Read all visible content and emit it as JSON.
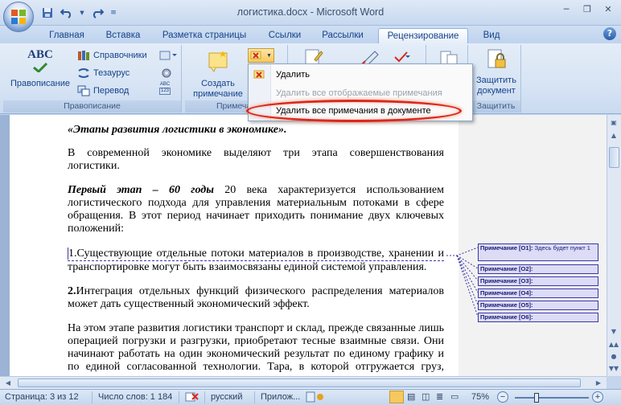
{
  "window": {
    "title": "логистика.docx - Microsoft Word",
    "minimize": "─",
    "maximize": "❐",
    "close": "✕"
  },
  "tabs": [
    "Главная",
    "Вставка",
    "Разметка страницы",
    "Ссылки",
    "Рассылки",
    "Рецензирование",
    "Вид"
  ],
  "active_tab": "Рецензирование",
  "help_label": "?",
  "ribbon": {
    "proofing": {
      "spelling_label": "Правописание",
      "spelling_glyph": "ABC",
      "research_label": "Справочники",
      "thesaurus_label": "Тезаурус",
      "translate_label": "Перевод",
      "group_label": "Правописание",
      "abc_small": "ABC",
      "num_small": "123"
    },
    "comments": {
      "new_comment_label_1": "Создать",
      "new_comment_label_2": "примечание",
      "group_label": "Примечан"
    },
    "protect": {
      "label_1": "Защитить",
      "label_2": "документ",
      "group_label": "Защитить"
    }
  },
  "delete_menu": {
    "items": [
      {
        "label": "Удалить",
        "enabled": true
      },
      {
        "label": "Удалить все отображаемые примечания",
        "enabled": false
      },
      {
        "label": "Удалить все примечания в документе",
        "enabled": true,
        "highlighted": true
      }
    ]
  },
  "document": {
    "heading": "«Этапы развития логистики в экономике».",
    "para1_l1": "В современной экономике выделяют три этапа совершенствования",
    "para1_l2": "логистики.",
    "para2_bold": "Первый этап – 60 годы",
    "para2_l1_rest": " 20 века характеризуется использованием",
    "para2_l2": "логистического подхода для управления материальным потоками в сфере",
    "para2_l3": "обращения. В этот период начинает приходить понимание двух ключевых",
    "para2_l4": "положений:",
    "item1_num": "1.",
    "item1_l1": "Существующие отдельные потоки материалов в производстве, хранении и",
    "item1_l2": "транспортировке могут быть взаимосвязаны единой системой управления.",
    "item2_num": "2.",
    "item2_l1": "Интеграция отдельных функций физического распределения материалов",
    "item2_l2": "может дать существенный экономический эффект.",
    "para3_l1": "На этом этапе развития логистики транспорт и склад, прежде связанные лишь",
    "para3_l2": "операцией погрузки и разгрузки, приобретают тесные взаимные связи. Они",
    "para3_l3": "начинают работать на один экономический результат по единому графику и",
    "para3_l4": "по единой согласованной технологии. Тара, в которой отгружается груз,"
  },
  "comments": [
    {
      "label": "Примечание [O1]:",
      "text": "Здесь будет пункт 1"
    },
    {
      "label": "Примечание [O2]:",
      "text": ""
    },
    {
      "label": "Примечание [O3]:",
      "text": ""
    },
    {
      "label": "Примечание [O4]:",
      "text": ""
    },
    {
      "label": "Примечание [O5]:",
      "text": ""
    },
    {
      "label": "Примечание [O6]:",
      "text": ""
    }
  ],
  "status": {
    "page": "Страница: 3 из 12",
    "words": "Число слов: 1 184",
    "language": "русский",
    "insert_mode": "Прилож...",
    "zoom": "75%"
  },
  "colors": {
    "accent": "#15428b",
    "highlight_oval": "#d9291e",
    "comment_border": "#3a37a8",
    "comment_fill": "#dcdcf7"
  }
}
